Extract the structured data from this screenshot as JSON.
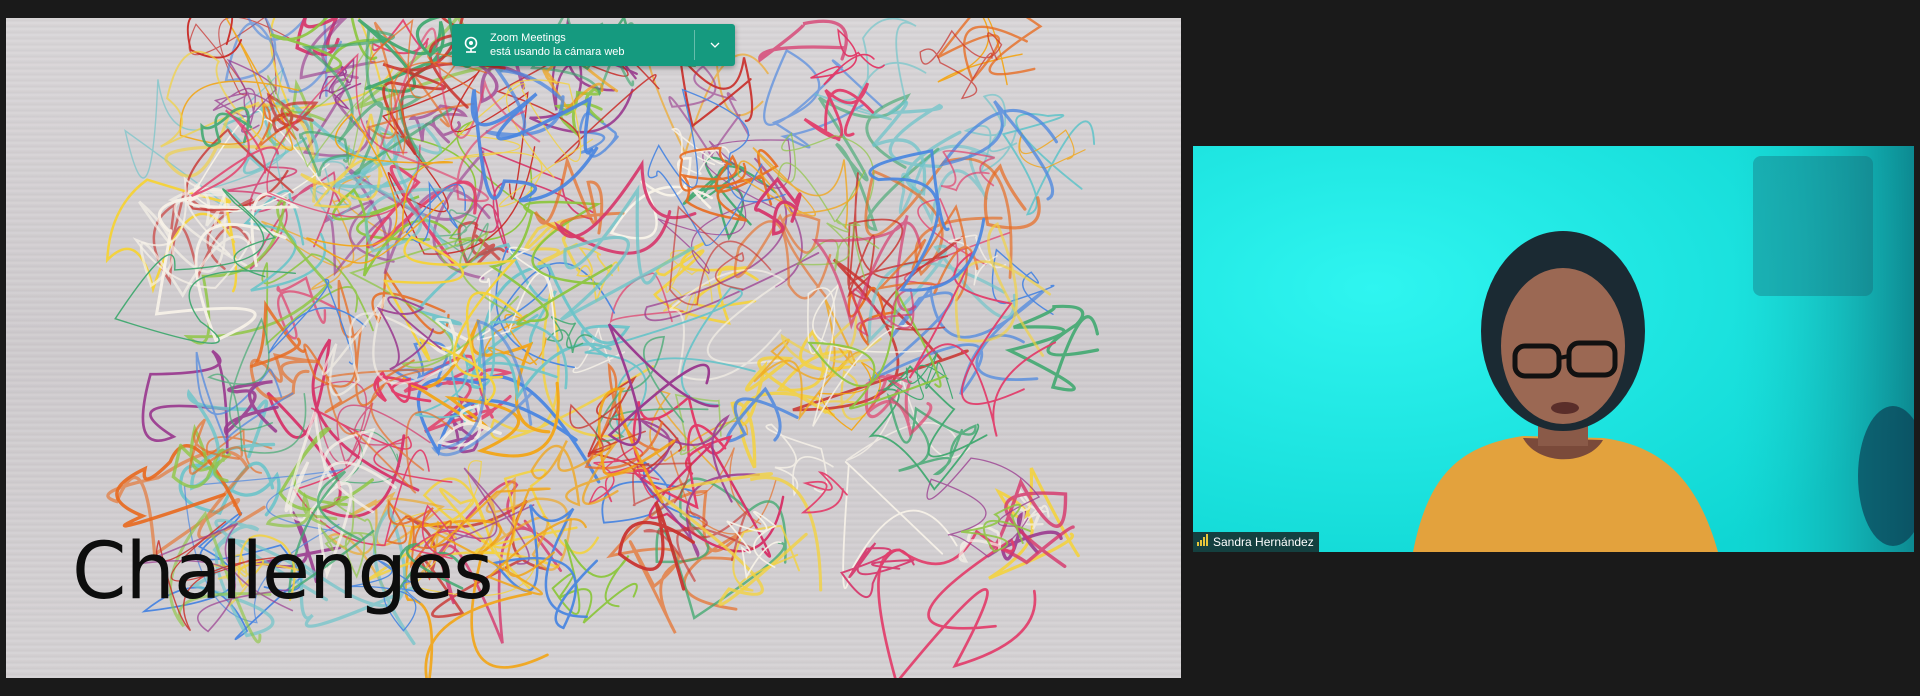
{
  "slide": {
    "title": "Challenges"
  },
  "notification": {
    "app_name": "Zoom Meetings",
    "message": "está usando la cámara web",
    "icon": "webcam-icon",
    "expand_icon": "chevron-down-icon",
    "color": "#159a7f"
  },
  "participant": {
    "name": "Sandra Hernández",
    "signal_icon": "signal-bars-icon",
    "video_background": "#14e2df"
  },
  "colors": {
    "background": "#1a1a1a"
  }
}
